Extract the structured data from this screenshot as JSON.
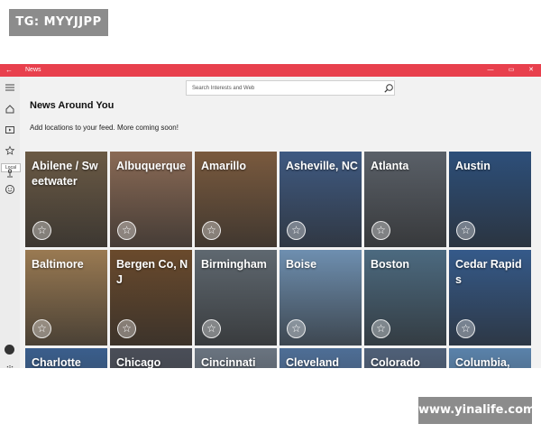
{
  "watermarks": {
    "top_left": "TG: MYYJJPP",
    "bottom_right": "www.yinalife.com"
  },
  "window": {
    "title": "News",
    "back_glyph": "←",
    "minimize_glyph": "—",
    "maximize_glyph": "▭",
    "close_glyph": "✕"
  },
  "search": {
    "placeholder": "Search Interests and Web",
    "icon": "search-icon"
  },
  "rail": {
    "icons": [
      "menu-icon",
      "home-icon",
      "play-icon",
      "star-icon",
      "local-icon",
      "smiley-icon"
    ],
    "tooltip": "Local",
    "bottom_icons": [
      "avatar",
      "settings-icon"
    ]
  },
  "page": {
    "heading": "News Around You",
    "subtext": "Add locations to your feed. More coming soon!"
  },
  "tiles": [
    {
      "label": "Abilene / Sweetwater",
      "bg": "#6b5a45"
    },
    {
      "label": "Albuquerque",
      "bg": "#8a6a55"
    },
    {
      "label": "Amarillo",
      "bg": "#7a5a3e"
    },
    {
      "label": "Asheville, NC",
      "bg": "#3f5a82"
    },
    {
      "label": "Atlanta",
      "bg": "#5a6068"
    },
    {
      "label": "Austin",
      "bg": "#2d4f7a"
    },
    {
      "label": "Baltimore",
      "bg": "#9a7a52"
    },
    {
      "label": "Bergen Co, NJ",
      "bg": "#6a4a2c"
    },
    {
      "label": "Birmingham",
      "bg": "#5f6870"
    },
    {
      "label": "Boise",
      "bg": "#6e8fb0"
    },
    {
      "label": "Boston",
      "bg": "#4c6a80"
    },
    {
      "label": "Cedar Rapids",
      "bg": "#355a8a"
    },
    {
      "label": "Charlotte",
      "bg": "#3a5e8c"
    },
    {
      "label": "Chicago",
      "bg": "#4a4e58"
    },
    {
      "label": "Cincinnati",
      "bg": "#6a7480"
    },
    {
      "label": "Cleveland",
      "bg": "#4e6e96"
    },
    {
      "label": "Colorado",
      "bg": "#4f6078"
    },
    {
      "label": "Columbia,",
      "bg": "#5a82aa"
    }
  ],
  "colors": {
    "accent": "#e8404d"
  }
}
